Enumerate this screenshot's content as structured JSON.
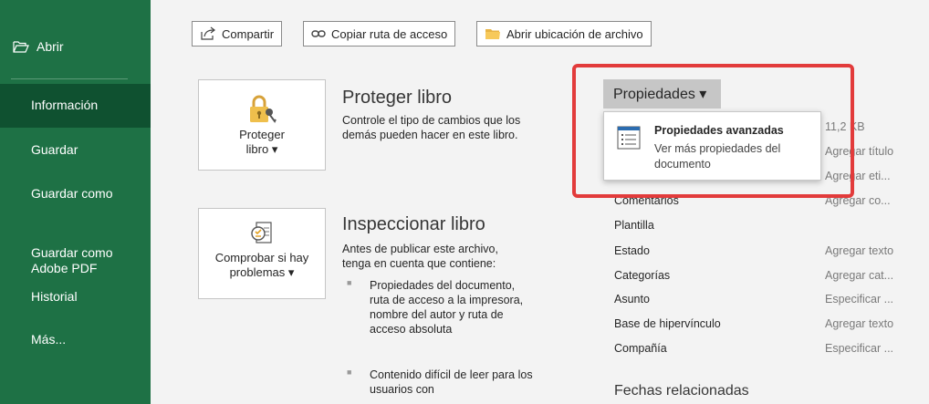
{
  "sidebar": {
    "open_label": "Abrir",
    "items": [
      {
        "label": "Información",
        "active": true
      },
      {
        "label": "Guardar",
        "active": false
      },
      {
        "label": "Guardar como",
        "active": false
      },
      {
        "label": "Guardar como\nAdobe PDF",
        "active": false
      },
      {
        "label": "Historial",
        "active": false
      },
      {
        "label": "Más...",
        "active": false
      }
    ],
    "colors": {
      "background": "#1e7145",
      "active": "#0f5130"
    }
  },
  "toolbar": {
    "share_label": "Compartir",
    "copy_path_label": "Copiar ruta de acceso",
    "open_location_label": "Abrir ubicación de archivo"
  },
  "protect": {
    "button_label": "Proteger\nlibro ▾",
    "title": "Proteger libro",
    "description": "Controle el tipo de cambios que los demás pueden hacer en este libro."
  },
  "inspect": {
    "button_label": "Comprobar si hay\nproblemas ▾",
    "title": "Inspeccionar libro",
    "description": "Antes de publicar este archivo, tenga en cuenta que contiene:",
    "bullets": [
      "Propiedades del documento, ruta de acceso a la impresora, nombre del autor y ruta de acceso absoluta",
      "Contenido difícil de leer para los usuarios con"
    ],
    "bullet_glyph": "■"
  },
  "properties": {
    "header_label": "Propiedades ▾",
    "rows": [
      {
        "label": "",
        "value": "11,2 KB"
      },
      {
        "label": "",
        "value": "Agregar título"
      },
      {
        "label": "",
        "value": "Agregar eti..."
      },
      {
        "label": "Comentarios",
        "value": "Agregar co..."
      },
      {
        "label": "Plantilla",
        "value": ""
      },
      {
        "label": "Estado",
        "value": "Agregar texto"
      },
      {
        "label": "Categorías",
        "value": "Agregar cat..."
      },
      {
        "label": "Asunto",
        "value": "Especificar ..."
      },
      {
        "label": "Base de hipervínculo",
        "value": "Agregar texto"
      },
      {
        "label": "Compañía",
        "value": "Especificar ..."
      }
    ],
    "dropdown": {
      "title": "Propiedades avanzadas",
      "description": "Ver más propiedades del documento"
    }
  },
  "related_dates": {
    "title": "Fechas relacionadas"
  },
  "highlight_color": "#e23b3b"
}
